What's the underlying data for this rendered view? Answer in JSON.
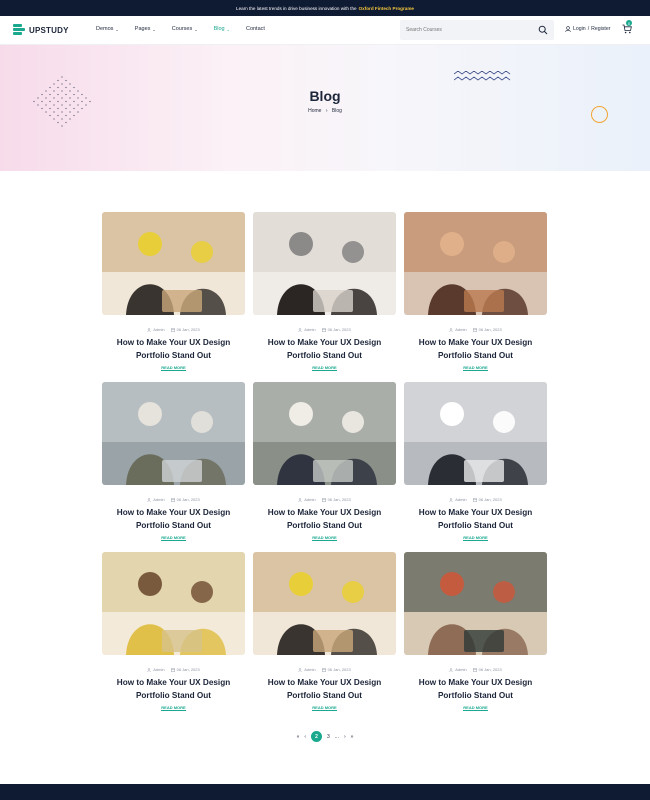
{
  "topbar": {
    "text": "Learn the latest trends in drive business innovation with the",
    "highlight": "Oxford Fintech Programe"
  },
  "header": {
    "logo": "UPSTUDY",
    "nav": [
      {
        "label": "Demos",
        "dropdown": true,
        "active": false
      },
      {
        "label": "Pages",
        "dropdown": true,
        "active": false
      },
      {
        "label": "Courses",
        "dropdown": true,
        "active": false
      },
      {
        "label": "Blog",
        "dropdown": true,
        "active": true
      },
      {
        "label": "Contact",
        "dropdown": false,
        "active": false
      }
    ],
    "search_placeholder": "Search Courses",
    "login": "Login",
    "login_sep": "/",
    "register": "Register",
    "cart_count": "0"
  },
  "hero": {
    "title": "Blog",
    "breadcrumb_home": "Home",
    "breadcrumb_current": "Blog"
  },
  "posts": [
    {
      "author": "Admin",
      "date": "06 Jan, 2023",
      "title_line1": "How to Make Your UX Design",
      "title_line2": "Portfolio Stand Out",
      "read_more": "READ MORE"
    },
    {
      "author": "Admin",
      "date": "06 Jan, 2023",
      "title_line1": "How to Make Your UX Design",
      "title_line2": "Portfolio Stand Out",
      "read_more": "READ MORE"
    },
    {
      "author": "Admin",
      "date": "06 Jan, 2023",
      "title_line1": "How to Make Your UX Design",
      "title_line2": "Portfolio Stand Out",
      "read_more": "READ MORE"
    },
    {
      "author": "Admin",
      "date": "06 Jan, 2023",
      "title_line1": "How to Make Your UX Design",
      "title_line2": "Portfolio Stand Out",
      "read_more": "READ MORE"
    },
    {
      "author": "Admin",
      "date": "06 Jan, 2023",
      "title_line1": "How to Make Your UX Design",
      "title_line2": "Portfolio Stand Out",
      "read_more": "READ MORE"
    },
    {
      "author": "Admin",
      "date": "06 Jan, 2023",
      "title_line1": "How to Make Your UX Design",
      "title_line2": "Portfolio Stand Out",
      "read_more": "READ MORE"
    },
    {
      "author": "Admin",
      "date": "06 Jan, 2023",
      "title_line1": "How to Make Your UX Design",
      "title_line2": "Portfolio Stand Out",
      "read_more": "READ MORE"
    },
    {
      "author": "Admin",
      "date": "06 Jan, 2023",
      "title_line1": "How to Make Your UX Design",
      "title_line2": "Portfolio Stand Out",
      "read_more": "READ MORE"
    },
    {
      "author": "Admin",
      "date": "06 Jan, 2023",
      "title_line1": "How to Make Your UX Design",
      "title_line2": "Portfolio Stand Out",
      "read_more": "READ MORE"
    }
  ],
  "pagination": {
    "prev_double": "«",
    "prev": "‹",
    "pages": [
      "2",
      "3"
    ],
    "ellipsis": "...",
    "next": "›",
    "next_double": "»",
    "current": "2"
  },
  "colors": {
    "accent": "#1aa88e",
    "dark": "#0f1b33",
    "highlight": "#f5c63d",
    "ring": "#f2a533"
  }
}
